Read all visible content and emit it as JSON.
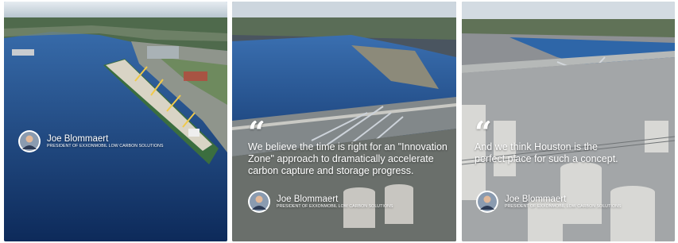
{
  "panels": [
    {
      "id": "panel-1",
      "quote_mark": "",
      "quote": "",
      "speaker": {
        "name": "Joe Blommaert",
        "title": "PRESIDENT OF EXXONMOBIL LOW CARBON SOLUTIONS"
      }
    },
    {
      "id": "panel-2",
      "quote_mark": "“",
      "quote": "We believe the time is right for an \"Innovation Zone\" approach to dramatically accelerate carbon capture and storage progress.",
      "speaker": {
        "name": "Joe Blommaert",
        "title": "PRESIDENT OF EXXONMOBIL LOW CARBON SOLUTIONS"
      }
    },
    {
      "id": "panel-3",
      "quote_mark": "“",
      "quote": "And we think Houston is the perfect place for such a concept.",
      "speaker": {
        "name": "Joe Blommaert",
        "title": "PRESIDENT OF EXXONMOBIL LOW CARBON SOLUTIONS"
      }
    }
  ],
  "icons": {
    "quote": "quote-icon",
    "avatar": "avatar"
  },
  "colors": {
    "water": "#1c4f8a",
    "sky": "#cfd8e0",
    "land": "#5d6b58",
    "text": "#ffffff"
  }
}
